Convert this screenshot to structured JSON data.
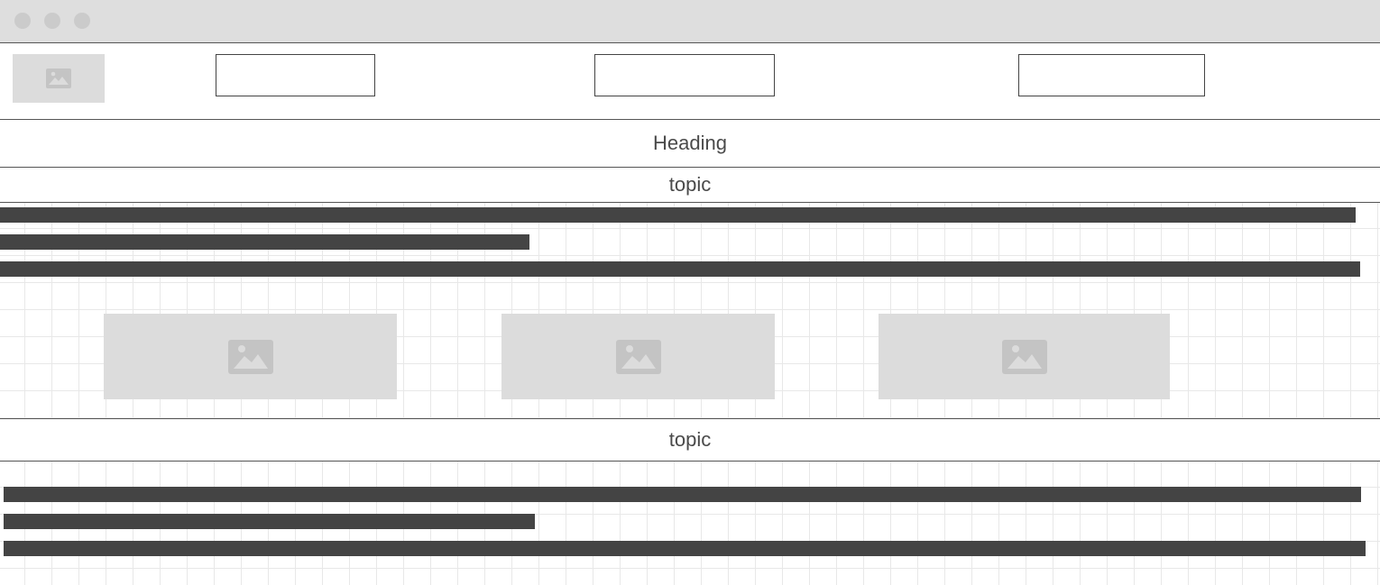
{
  "window": {
    "controls": [
      "close",
      "minimize",
      "maximize"
    ]
  },
  "header": {
    "logo": {
      "icon": "image-icon"
    },
    "nav_items": [
      {
        "label": ""
      },
      {
        "label": ""
      },
      {
        "label": ""
      }
    ]
  },
  "main": {
    "heading": "Heading",
    "sections": [
      {
        "topic": "topic",
        "paragraph_lines": 3,
        "images": [
          {
            "icon": "image-icon"
          },
          {
            "icon": "image-icon"
          },
          {
            "icon": "image-icon"
          }
        ]
      },
      {
        "topic": "topic",
        "paragraph_lines": 3
      }
    ]
  },
  "colors": {
    "titlebar": "#dedede",
    "placeholder": "#dcdcdc",
    "text_bar": "#444444",
    "grid_line": "#e8e8e8"
  }
}
